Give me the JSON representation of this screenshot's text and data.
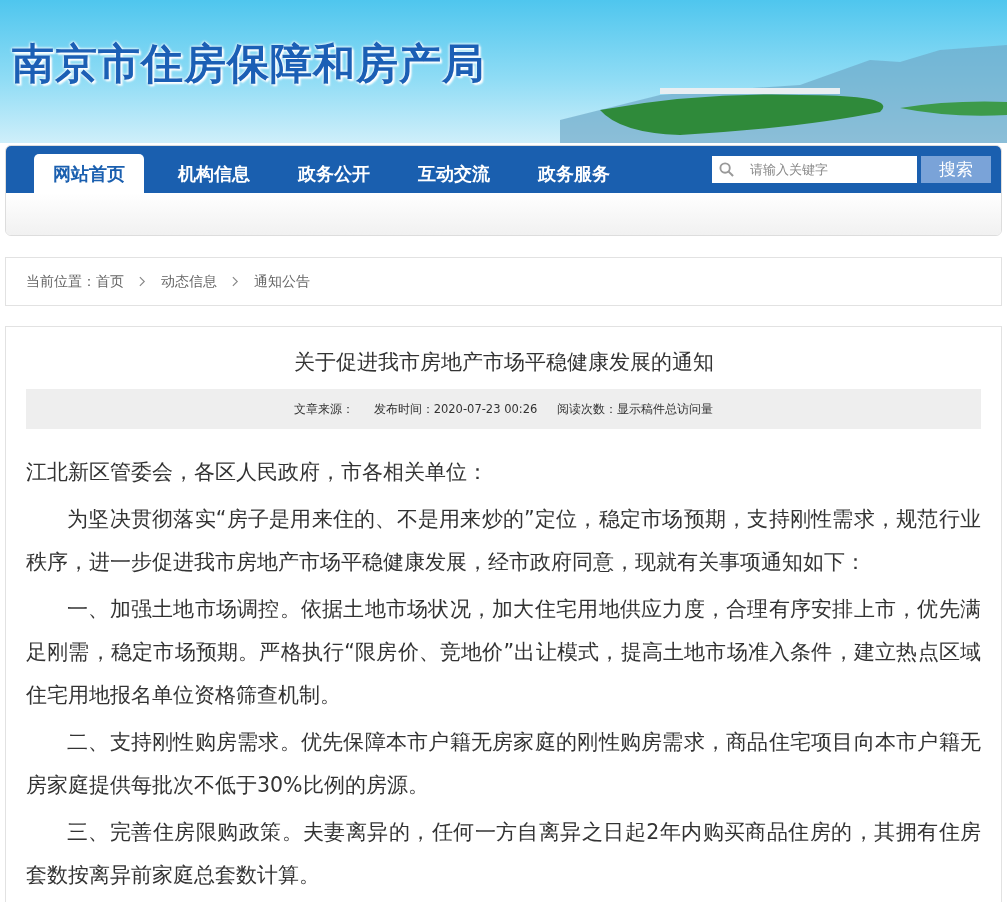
{
  "site_title": "南京市住房保障和房产局",
  "nav": [
    {
      "label": "网站首页",
      "selected": true
    },
    {
      "label": "机构信息",
      "selected": false
    },
    {
      "label": "政务公开",
      "selected": false
    },
    {
      "label": "互动交流",
      "selected": false
    },
    {
      "label": "政务服务",
      "selected": false
    }
  ],
  "search": {
    "placeholder": "请输入关键字",
    "button": "搜索"
  },
  "breadcrumb": {
    "label": "当前位置：",
    "items": [
      "首页",
      "动态信息",
      "通知公告"
    ]
  },
  "article": {
    "title": "关于促进我市房地产市场平稳健康发展的通知",
    "meta": [
      "文章来源：",
      "发布时间：2020-07-23 00:26",
      "阅读次数：显示稿件总访问量"
    ],
    "greeting": "江北新区管委会，各区人民政府，市各相关单位：",
    "paragraphs": [
      "为坚决贯彻落实“房子是用来住的、不是用来炒的”定位，稳定市场预期，支持刚性需求，规范行业秩序，进一步促进我市房地产市场平稳健康发展，经市政府同意，现就有关事项通知如下：",
      "一、加强土地市场调控。依据土地市场状况，加大住宅用地供应力度，合理有序安排上市，优先满足刚需，稳定市场预期。严格执行“限房价、竞地价”出让模式，提高土地市场准入条件，建立热点区域住宅用地报名单位资格筛查机制。",
      "二、支持刚性购房需求。优先保障本市户籍无房家庭的刚性购房需求，商品住宅项目向本市户籍无房家庭提供每批次不低于30%比例的房源。",
      "三、完善住房限购政策。夫妻离异的，任何一方自离异之日起2年内购买商品住房的，其拥有住房套数按离异前家庭总套数计算。"
    ]
  }
}
